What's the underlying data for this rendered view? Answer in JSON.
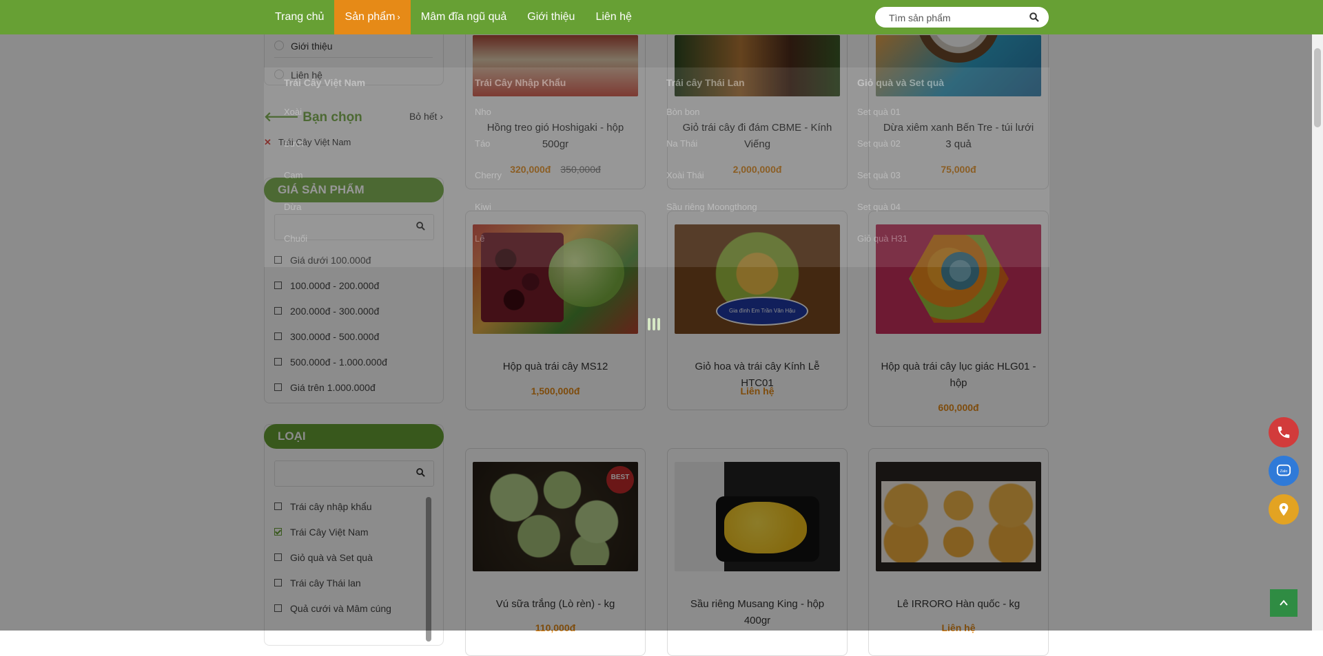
{
  "nav": {
    "items": [
      {
        "label": "Trang chủ",
        "active": false
      },
      {
        "label": "Sản phẩm",
        "active": true
      },
      {
        "label": "Mâm đĩa ngũ quả",
        "active": false
      },
      {
        "label": "Giới thiệu",
        "active": false
      },
      {
        "label": "Liên hệ",
        "active": false
      }
    ],
    "search_placeholder": "Tìm sản phẩm",
    "bg_color": "#67a034",
    "active_color": "#e68a17"
  },
  "sidebar": {
    "mini_menu": [
      "Giới thiệu",
      "Liên hệ"
    ],
    "selected_title": "Bạn chọn",
    "clear_all": "Bỏ hết",
    "selected_chip": "Trái Cây Việt Nam",
    "price_title": "GIÁ SẢN PHẨM",
    "price_options": [
      "Giá dưới 100.000đ",
      "100.000đ - 200.000đ",
      "200.000đ - 300.000đ",
      "300.000đ - 500.000đ",
      "500.000đ - 1.000.000đ",
      "Giá trên 1.000.000đ"
    ],
    "type_title": "LOẠI",
    "type_options": [
      {
        "label": "Trái cây nhập khẩu",
        "checked": false
      },
      {
        "label": "Trái Cây Việt Nam",
        "checked": true
      },
      {
        "label": "Giỏ quà và Set quà",
        "checked": false
      },
      {
        "label": "Trái cây Thái lan",
        "checked": false
      },
      {
        "label": "Quả cưới và Mâm cúng",
        "checked": false
      }
    ]
  },
  "products": [
    {
      "name": "Hồng treo gió Hoshigaki - hộp 500gr",
      "price": "320,000đ",
      "old_price": "350,000đ"
    },
    {
      "name": "Giỏ trái cây đi đám CBME - Kính Viếng",
      "price": "2,000,000đ",
      "old_price": ""
    },
    {
      "name": "Dừa xiêm xanh Bến Tre - túi lưới 3 quả",
      "price": "75,000đ",
      "old_price": ""
    },
    {
      "name": "Hộp quà trái cây MS12",
      "price": "1,500,000đ",
      "old_price": ""
    },
    {
      "name": "Giỏ hoa và trái cây Kính Lễ HTC01",
      "price": "Liên hệ",
      "old_price": ""
    },
    {
      "name": "Hộp quà trái cây lục giác HLG01 - hộp",
      "price": "600,000đ",
      "old_price": ""
    },
    {
      "name": "Vú sữa trắng (Lò rèn) - kg",
      "price": "110,000đ",
      "old_price": ""
    },
    {
      "name": "Sầu riêng Musang King - hộp 400gr",
      "price": "",
      "old_price": ""
    },
    {
      "name": "Lê IRRORO Hàn quốc - kg",
      "price": "Liên hệ",
      "old_price": ""
    }
  ],
  "mega_menu": {
    "columns": [
      {
        "title": "Trái Cây Việt Nam",
        "items": [
          "Xoài",
          "Bưởi",
          "Cam",
          "Dừa",
          "Chuối"
        ]
      },
      {
        "title": "Trái Cây Nhập Khẩu",
        "items": [
          "Nho",
          "Táo",
          "Cherry",
          "Kiwi",
          "Lê"
        ]
      },
      {
        "title": "Trái cây Thái Lan",
        "items": [
          "Bòn bon",
          "Na Thái",
          "Xoài Thái",
          "Sầu riêng Moongthong"
        ]
      },
      {
        "title": "Giỏ quà và Set quà",
        "items": [
          "Set quà 01",
          "Set quà 02",
          "Set quà 03",
          "Set quà 04",
          "Giỏ quà H31"
        ]
      }
    ]
  },
  "floating": {
    "icons": [
      "phone-icon",
      "zalo-icon",
      "map-pin-icon",
      "arrow-up-icon"
    ],
    "zalo_label": "Zalo",
    "colors": {
      "phone": "#d23b3b",
      "zalo": "#2f7ad8",
      "map": "#e3a322",
      "top": "#2f8c43"
    }
  }
}
